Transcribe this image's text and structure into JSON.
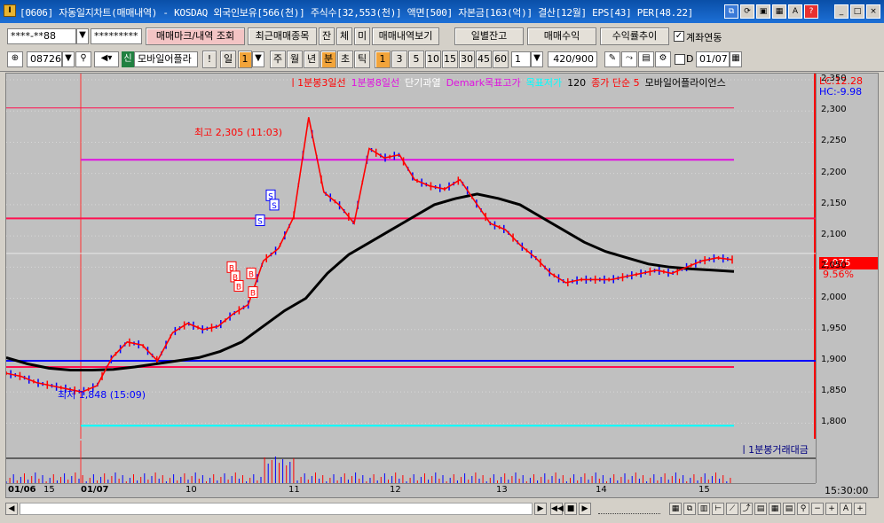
{
  "window": {
    "title": "[0606] 자동일지차트(매매내역) - KOSDAQ 외국인보유[566(천)] 주식수[32,553(천)] 액면[500] 자본금[163(억)] 결산[12월] EPS[43] PER[48.22]",
    "app_icon": "I"
  },
  "toolbar1": {
    "account": "****-**88",
    "password": "*********",
    "trade_mark_btn": "매매마크/내역 조회",
    "recent_btn": "최근매매종목",
    "jan_btn": "잔",
    "che_btn": "체",
    "mi_btn": "미",
    "history_btn": "매매내역보기",
    "daily_balance_btn": "일별잔고",
    "profit_btn": "매매수익",
    "return_trend_btn": "수익률추이",
    "account_link_label": "계좌연동",
    "account_link_checked": true
  },
  "toolbar2": {
    "stock_code": "087260",
    "badge": "신",
    "stock_name": "모바일어플라",
    "exclaim": "!",
    "period_day": "일",
    "period_n": "1",
    "periods": [
      "주",
      "월",
      "년",
      "분",
      "초",
      "틱"
    ],
    "minutes": [
      "1",
      "3",
      "5",
      "10",
      "15",
      "30",
      "45",
      "60"
    ],
    "step": "1",
    "count": "420/900",
    "d_label": "D",
    "date": "01/07"
  },
  "legend": [
    {
      "text": "ㅣ1분봉3일선",
      "color": "#ff0000"
    },
    {
      "text": "1분봉8일선",
      "color": "#e010e0"
    },
    {
      "text": "단기과열",
      "color": "#ffffff"
    },
    {
      "text": "Demark목표고가",
      "color": "#e010e0"
    },
    {
      "text": "목표저가",
      "color": "#00ffff"
    },
    {
      "text": "120",
      "color": "#000000"
    },
    {
      "text": "종가 단순 5",
      "color": "#ff0000"
    },
    {
      "text": "모바일어플라이언스",
      "color": "#000000"
    }
  ],
  "annotations": {
    "high": "최고 2,305 (11:03)",
    "low": "최저 1,848 (15:09)",
    "lc": "LC:12.28",
    "hc": "HC:-9.98",
    "price_tag": "2,075",
    "pct_tag": "9.56%",
    "vol_legend": "ㅣ1분봉거래대금",
    "time_label": "15:30:00"
  },
  "colors": {
    "up": "#ff0000",
    "down": "#0000ff",
    "ma120": "#000000",
    "ma5": "#ff0000",
    "demark_high": "#e010e0",
    "demark_low": "#00ffff",
    "red_line": "#ff1050",
    "blue_line": "#0000ff",
    "bg": "#c0c0c0"
  },
  "chart_data": {
    "type": "line",
    "title": "",
    "xlabel": "",
    "ylabel": "",
    "x": [
      "01/06",
      "15",
      "01/07",
      "10",
      "11",
      "12",
      "13",
      "14",
      "15"
    ],
    "ylim": [
      1775,
      2360
    ],
    "yticks": [
      1800,
      1850,
      1900,
      1950,
      2000,
      2050,
      2100,
      2150,
      2200,
      2250,
      2300,
      2350
    ],
    "ytick_labels": [
      "1,800",
      "1,850",
      "1,900",
      "1,950",
      "2,000",
      "2,050",
      "2,100",
      "2,150",
      "2,200",
      "2,250",
      "2,300",
      "2,350"
    ],
    "horizontal_lines": {
      "top_red": 2305,
      "magenta": 2222,
      "red_mid": 2128,
      "grey": 2072,
      "blue": 1900,
      "red_low": 1890,
      "cyan": 1796
    },
    "series": [
      {
        "name": "종가 단순 5",
        "values": [
          1880,
          1875,
          1865,
          1860,
          1855,
          1850,
          1860,
          1905,
          1930,
          1925,
          1900,
          1945,
          1960,
          1950,
          1955,
          1975,
          1990,
          2060,
          2080,
          2130,
          2290,
          2170,
          2150,
          2120,
          2240,
          2225,
          2230,
          2190,
          2180,
          2175,
          2190,
          2155,
          2120,
          2110,
          2085,
          2065,
          2040,
          2025,
          2030,
          2030,
          2030,
          2035,
          2040,
          2045,
          2040,
          2050,
          2060,
          2065,
          2062
        ]
      },
      {
        "name": "120",
        "values": [
          1905,
          1895,
          1888,
          1885,
          1885,
          1886,
          1890,
          1895,
          1900,
          1905,
          1915,
          1930,
          1955,
          1980,
          2000,
          2040,
          2070,
          2090,
          2110,
          2130,
          2150,
          2160,
          2167,
          2160,
          2150,
          2130,
          2110,
          2090,
          2075,
          2065,
          2055,
          2050,
          2047,
          2045,
          2043
        ]
      }
    ],
    "markers": [
      {
        "label": "B",
        "value": 2050
      },
      {
        "label": "B",
        "value": 2035
      },
      {
        "label": "B",
        "value": 2020
      },
      {
        "label": "B",
        "value": 2040
      },
      {
        "label": "B",
        "value": 2010
      },
      {
        "label": "S",
        "value": 2165
      },
      {
        "label": "S",
        "value": 2150
      },
      {
        "label": "S",
        "value": 2125
      }
    ],
    "volume_axis_label": "1분봉거래대금"
  },
  "scrollbar": {
    "icons": [
      "play-icon",
      "rewind-icon",
      "pause-icon",
      "forward-icon"
    ]
  }
}
